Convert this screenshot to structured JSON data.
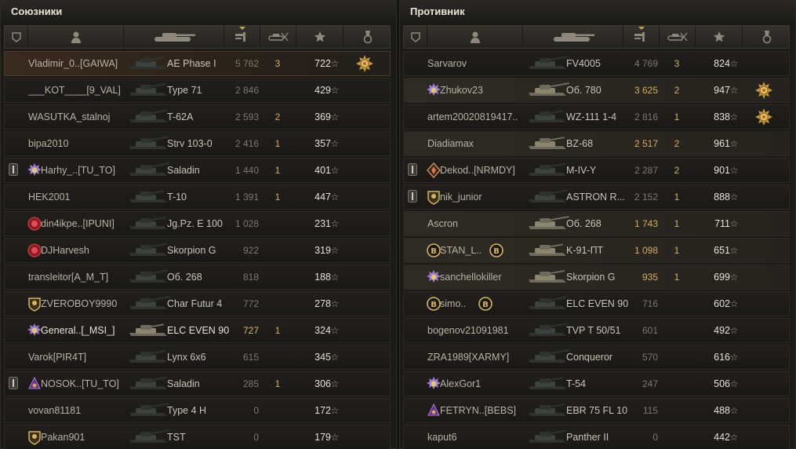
{
  "teams": [
    {
      "title": "Союзники",
      "rows": [
        {
          "platoon": false,
          "badge": "",
          "name": "Vladimir_0..[GAIWA]",
          "tank": "AE Phase I",
          "damage": "5 762",
          "damage_gold": false,
          "kills": "3",
          "xp": "722",
          "award": "gold-medal-icon",
          "highlight": "hl"
        },
        {
          "platoon": false,
          "badge": "",
          "name": "___KOT____[9_VAL]",
          "tank": "Type 71",
          "damage": "2 846",
          "damage_gold": false,
          "kills": "",
          "xp": "429",
          "award": "",
          "highlight": ""
        },
        {
          "platoon": false,
          "badge": "",
          "name": "WASUTKA_stalnoj",
          "tank": "T-62A",
          "damage": "2 593",
          "damage_gold": false,
          "kills": "2",
          "xp": "369",
          "award": "",
          "highlight": ""
        },
        {
          "platoon": false,
          "badge": "",
          "name": "bipa2010",
          "tank": "Strv 103-0",
          "damage": "2 416",
          "damage_gold": false,
          "kills": "1",
          "xp": "357",
          "award": "",
          "highlight": ""
        },
        {
          "platoon": true,
          "badge": "purple",
          "name": "Harhy_..[TU_TO]",
          "tank": "Saladin",
          "damage": "1 440",
          "damage_gold": false,
          "kills": "1",
          "xp": "401",
          "award": "",
          "highlight": ""
        },
        {
          "platoon": false,
          "badge": "",
          "name": "HEK2001",
          "tank": "T-10",
          "damage": "1 391",
          "damage_gold": false,
          "kills": "1",
          "xp": "447",
          "award": "",
          "highlight": ""
        },
        {
          "platoon": false,
          "badge": "red",
          "name": "din4ikpe..[IPUNI]",
          "tank": "Jg.Pz. E 100",
          "damage": "1 028",
          "damage_gold": false,
          "kills": "",
          "xp": "231",
          "award": "",
          "highlight": ""
        },
        {
          "platoon": false,
          "badge": "red",
          "name": "DJHarvesh",
          "tank": "Skorpion G",
          "damage": "922",
          "damage_gold": false,
          "kills": "",
          "xp": "319",
          "award": "",
          "highlight": ""
        },
        {
          "platoon": false,
          "badge": "",
          "name": "transleitor[A_M_T]",
          "tank": "Об. 268",
          "damage": "818",
          "damage_gold": false,
          "kills": "",
          "xp": "188",
          "award": "",
          "highlight": ""
        },
        {
          "platoon": false,
          "badge": "gold",
          "name": "ZVEROBOY9990",
          "tank": "Char Futur 4",
          "damage": "772",
          "damage_gold": false,
          "kills": "",
          "xp": "278",
          "award": "",
          "highlight": ""
        },
        {
          "platoon": false,
          "badge": "purple",
          "name": "General..[_MSI_]",
          "tank": "ELC EVEN 90",
          "damage": "727",
          "damage_gold": true,
          "kills": "1",
          "xp": "324",
          "award": "",
          "highlight": "me"
        },
        {
          "platoon": false,
          "badge": "",
          "name": "Varok[PIR4T]",
          "tank": "Lynx 6x6",
          "damage": "615",
          "damage_gold": false,
          "kills": "",
          "xp": "345",
          "award": "",
          "highlight": ""
        },
        {
          "platoon": true,
          "badge": "violet",
          "name": "NOSOK..[TU_TO]",
          "tank": "Saladin",
          "damage": "285",
          "damage_gold": false,
          "kills": "1",
          "xp": "306",
          "award": "",
          "highlight": ""
        },
        {
          "platoon": false,
          "badge": "",
          "name": "vovan81181",
          "tank": "Type 4 H",
          "damage": "0",
          "damage_gold": false,
          "kills": "",
          "xp": "172",
          "award": "",
          "highlight": ""
        },
        {
          "platoon": false,
          "badge": "gold",
          "name": "Pakan901",
          "tank": "TST",
          "damage": "0",
          "damage_gold": false,
          "kills": "",
          "xp": "179",
          "award": "",
          "highlight": ""
        }
      ]
    },
    {
      "title": "Противник",
      "rows": [
        {
          "platoon": false,
          "badge": "",
          "name": "Sarvarov",
          "tank": "FV4005",
          "damage": "4 769",
          "damage_gold": false,
          "kills": "3",
          "xp": "824",
          "award": "",
          "highlight": ""
        },
        {
          "platoon": false,
          "badge": "purple",
          "name": "Zhukov23",
          "tank": "Об. 780",
          "damage": "3 625",
          "damage_gold": true,
          "kills": "2",
          "xp": "947",
          "award": "gold-medal-icon",
          "highlight": "hl-e"
        },
        {
          "platoon": false,
          "badge": "",
          "name": "artem20020819417..",
          "tank": "WZ-111 1-4",
          "damage": "2 816",
          "damage_gold": false,
          "kills": "1",
          "xp": "838",
          "award": "gold-medal-icon",
          "highlight": ""
        },
        {
          "platoon": false,
          "badge": "",
          "name": "Diadiamax",
          "tank": "BZ-68",
          "damage": "2 517",
          "damage_gold": true,
          "kills": "2",
          "xp": "961",
          "award": "",
          "highlight": "hl-e"
        },
        {
          "platoon": true,
          "badge": "orange",
          "name": "Dekod..[NRMDY]",
          "tank": "M-IV-Y",
          "damage": "2 287",
          "damage_gold": false,
          "kills": "2",
          "xp": "901",
          "award": "",
          "highlight": ""
        },
        {
          "platoon": true,
          "badge": "gold",
          "name": "nik_junior",
          "tank": "ASTRON R...",
          "damage": "2 152",
          "damage_gold": false,
          "kills": "1",
          "xp": "888",
          "award": "",
          "highlight": ""
        },
        {
          "platoon": false,
          "badge": "",
          "name": "Ascron",
          "tank": "Об. 268",
          "damage": "1 743",
          "damage_gold": true,
          "kills": "1",
          "xp": "711",
          "award": "",
          "highlight": "hl-e"
        },
        {
          "platoon": false,
          "badge": "bonus",
          "name": "STAN_L..",
          "tank": "K-91-ПТ",
          "damage": "1 098",
          "damage_gold": true,
          "kills": "1",
          "xp": "651",
          "award": "",
          "highlight": "hl-e"
        },
        {
          "platoon": false,
          "badge": "purple",
          "name": "sanchellokiller",
          "tank": "Skorpion G",
          "damage": "935",
          "damage_gold": true,
          "kills": "1",
          "xp": "699",
          "award": "",
          "highlight": "hl-e"
        },
        {
          "platoon": false,
          "badge": "bonus",
          "name": "simo..",
          "tank": "ELC EVEN 90",
          "damage": "716",
          "damage_gold": false,
          "kills": "",
          "xp": "602",
          "award": "",
          "highlight": ""
        },
        {
          "platoon": false,
          "badge": "",
          "name": "bogenov21091981",
          "tank": "TVP T 50/51",
          "damage": "601",
          "damage_gold": false,
          "kills": "",
          "xp": "492",
          "award": "",
          "highlight": ""
        },
        {
          "platoon": false,
          "badge": "",
          "name": "ZRA1989[XARMY]",
          "tank": "Conqueror",
          "damage": "570",
          "damage_gold": false,
          "kills": "",
          "xp": "616",
          "award": "",
          "highlight": ""
        },
        {
          "platoon": false,
          "badge": "purple",
          "name": "AlexGor1",
          "tank": "T-54",
          "damage": "247",
          "damage_gold": false,
          "kills": "",
          "xp": "506",
          "award": "",
          "highlight": ""
        },
        {
          "platoon": false,
          "badge": "violet",
          "name": "FETRYN..[BEBS]",
          "tank": "EBR 75 FL 10",
          "damage": "115",
          "damage_gold": false,
          "kills": "",
          "xp": "488",
          "award": "",
          "highlight": ""
        },
        {
          "platoon": false,
          "badge": "",
          "name": "kaput6",
          "tank": "Panther II",
          "damage": "0",
          "damage_gold": false,
          "kills": "",
          "xp": "442",
          "award": "",
          "highlight": ""
        }
      ]
    }
  ],
  "colors": {
    "accent_gold": "#d5ae5a",
    "row_bg": "#1f1d1a",
    "me_highlight": "#3a2a1e"
  }
}
